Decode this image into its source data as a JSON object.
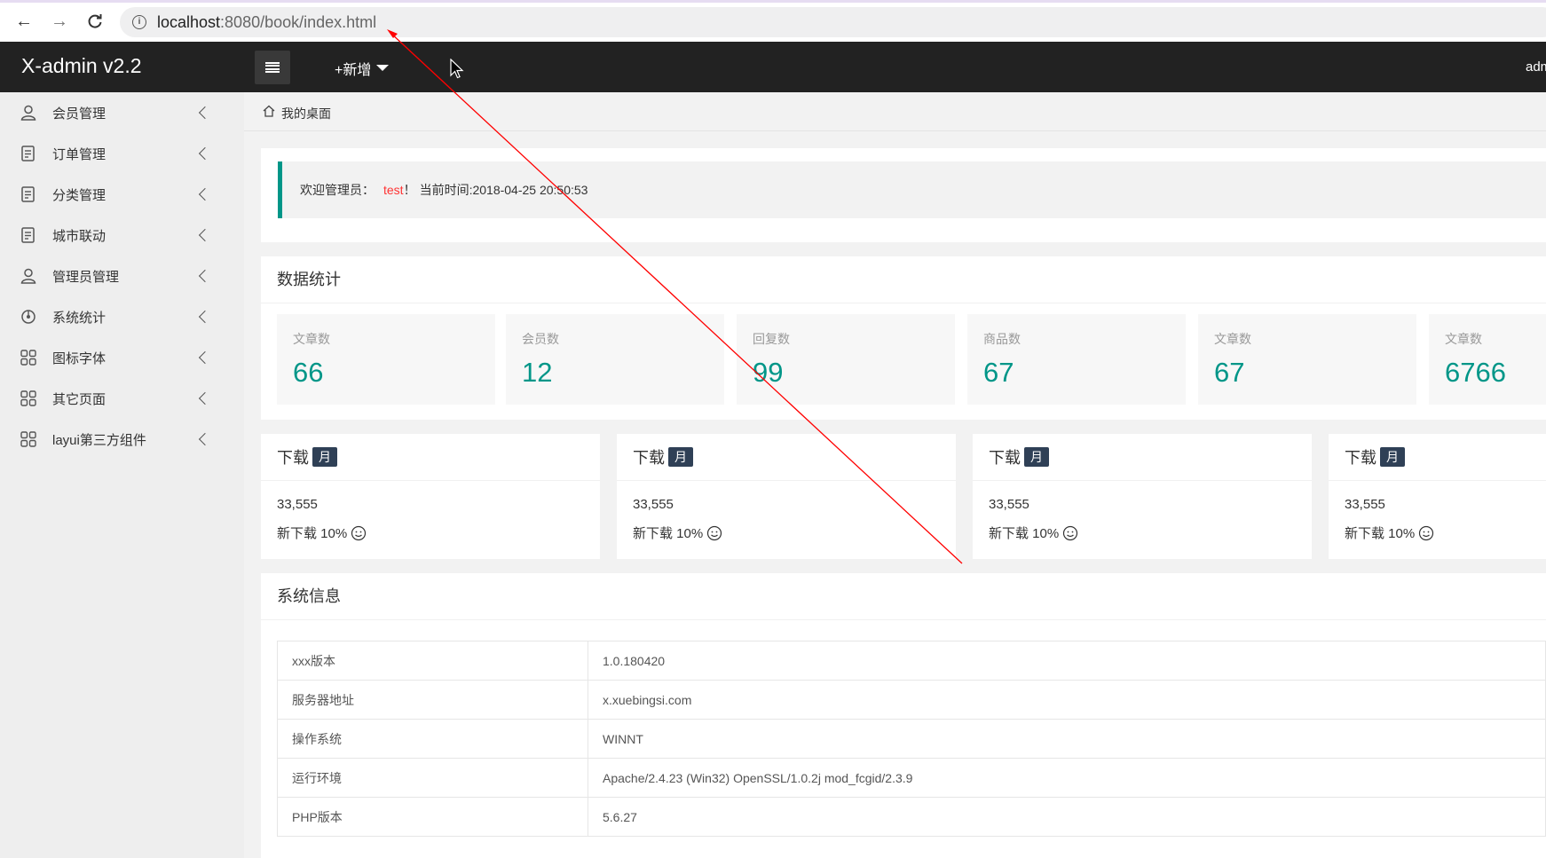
{
  "browser": {
    "url_host": "localhost",
    "url_rest": ":8080/book/index.html",
    "icons": [
      "back-arrow-icon",
      "forward-arrow-icon",
      "reload-icon",
      "info-icon"
    ]
  },
  "header": {
    "logo": "X-admin v2.2",
    "add_menu": "+新增",
    "user": "admin"
  },
  "sidebar": {
    "items": [
      {
        "label": "会员管理",
        "icon": "user-icon"
      },
      {
        "label": "订单管理",
        "icon": "document-icon"
      },
      {
        "label": "分类管理",
        "icon": "document-icon"
      },
      {
        "label": "城市联动",
        "icon": "document-icon"
      },
      {
        "label": "管理员管理",
        "icon": "user-icon"
      },
      {
        "label": "系统统计",
        "icon": "chart-icon"
      },
      {
        "label": "图标字体",
        "icon": "grid-icon"
      },
      {
        "label": "其它页面",
        "icon": "grid-icon"
      },
      {
        "label": "layui第三方组件",
        "icon": "grid-icon"
      }
    ]
  },
  "breadcrumb": {
    "label": "我的桌面"
  },
  "welcome": {
    "prefix": "欢迎管理员：",
    "user": "test",
    "suffix": "！",
    "time": "当前时间:2018-04-25 20:50:53"
  },
  "stats": {
    "title": "数据统计",
    "items": [
      {
        "label": "文章数",
        "value": "66"
      },
      {
        "label": "会员数",
        "value": "12"
      },
      {
        "label": "回复数",
        "value": "99"
      },
      {
        "label": "商品数",
        "value": "67"
      },
      {
        "label": "文章数",
        "value": "67"
      },
      {
        "label": "文章数",
        "value": "6766"
      }
    ]
  },
  "downloads": [
    {
      "title": "下载",
      "badge": "月",
      "count": "33,555",
      "new_label": "新下载 10%"
    },
    {
      "title": "下载",
      "badge": "月",
      "count": "33,555",
      "new_label": "新下载 10%"
    },
    {
      "title": "下载",
      "badge": "月",
      "count": "33,555",
      "new_label": "新下载 10%"
    },
    {
      "title": "下载",
      "badge": "月",
      "count": "33,555",
      "new_label": "新下载 10%"
    }
  ],
  "system": {
    "title": "系统信息",
    "rows": [
      {
        "key": "xxx版本",
        "value": "1.0.180420"
      },
      {
        "key": "服务器地址",
        "value": "x.xuebingsi.com"
      },
      {
        "key": "操作系统",
        "value": "WINNT"
      },
      {
        "key": "运行环境",
        "value": "Apache/2.4.23 (Win32) OpenSSL/1.0.2j mod_fcgid/2.3.9"
      },
      {
        "key": "PHP版本",
        "value": "5.6.27"
      }
    ]
  },
  "colors": {
    "accent": "#009688",
    "header_bg": "#222222",
    "badge_bg": "#2f4056",
    "highlight_red": "#ff3333",
    "annotation_line": "#ff0000"
  }
}
